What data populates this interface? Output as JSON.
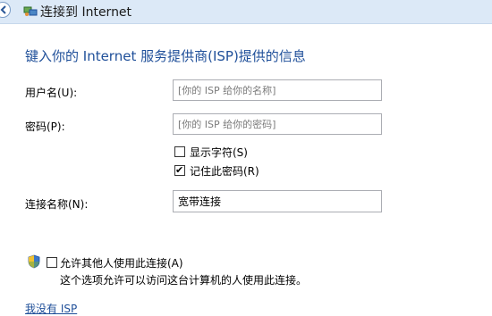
{
  "window": {
    "title": "连接到 Internet"
  },
  "page": {
    "heading": "键入你的 Internet 服务提供商(ISP)提供的信息"
  },
  "form": {
    "username": {
      "label": "用户名(U):",
      "value": "",
      "placeholder": "[你的 ISP 给你的名称]"
    },
    "password": {
      "label": "密码(P):",
      "value": "",
      "placeholder": "[你的 ISP 给你的密码]"
    },
    "show_chars": {
      "label": "显示字符(S)",
      "checked": false
    },
    "remember_password": {
      "label": "记住此密码(R)",
      "checked": true
    },
    "connection_name": {
      "label": "连接名称(N):",
      "value": "宽带连接"
    }
  },
  "sharing": {
    "icon": "uac-shield-icon",
    "checkbox_label": "允许其他人使用此连接(A)",
    "checked": false,
    "hint": "这个选项允许可以访问这台计算机的人使用此连接。"
  },
  "link": {
    "no_isp": "我没有 ISP"
  },
  "colors": {
    "heading": "#1f4f99",
    "link": "#1f4f99",
    "topbar": "#dce9f7"
  }
}
